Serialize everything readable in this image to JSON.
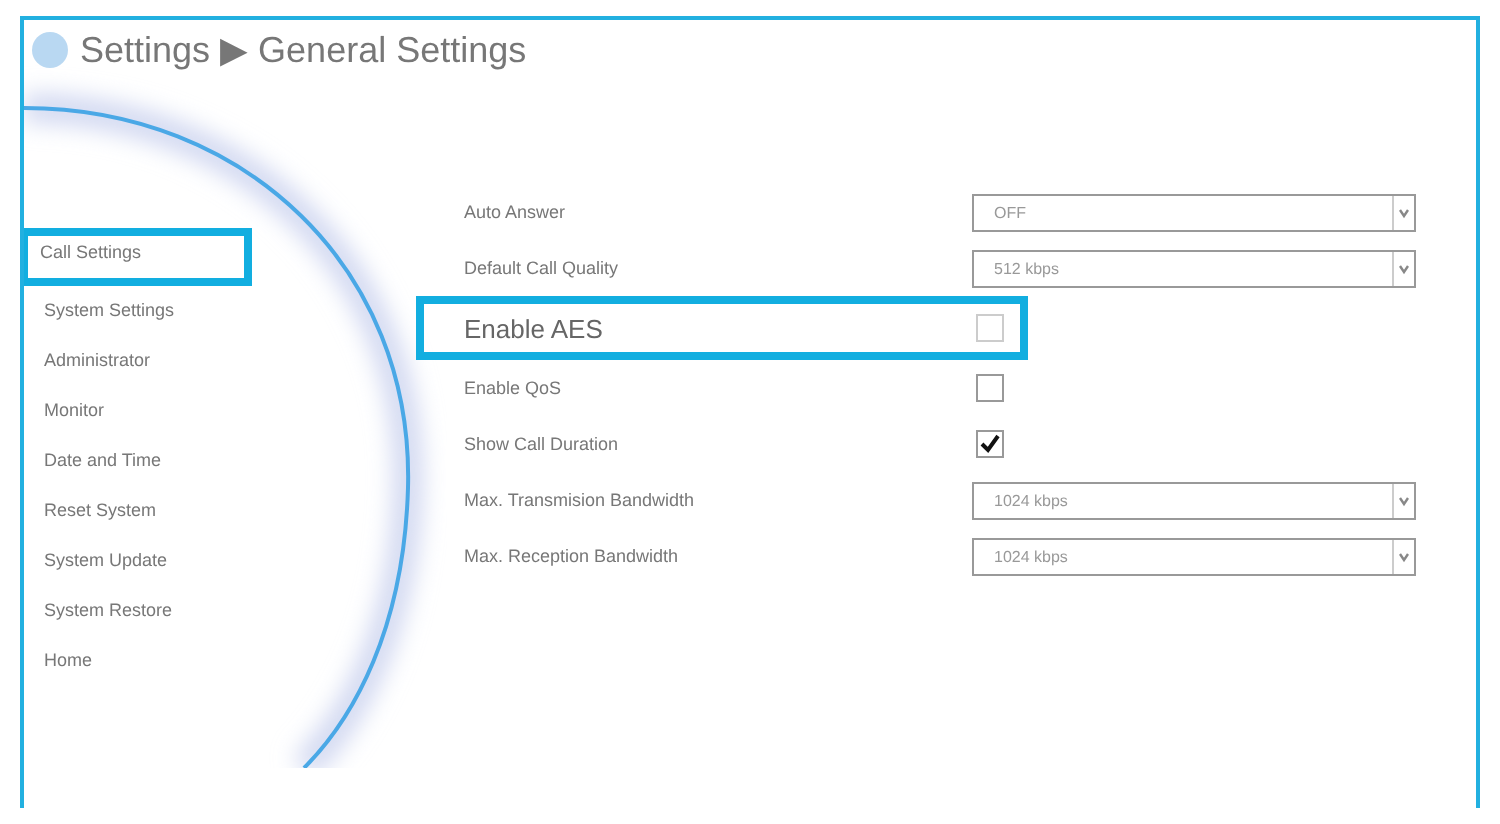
{
  "header": {
    "title": "Settings ▶ General Settings"
  },
  "sidebar": {
    "items": [
      {
        "label": "Call Settings",
        "selected": true
      },
      {
        "label": "System Settings",
        "selected": false
      },
      {
        "label": "Administrator",
        "selected": false
      },
      {
        "label": "Monitor",
        "selected": false
      },
      {
        "label": "Date and Time",
        "selected": false
      },
      {
        "label": "Reset System",
        "selected": false
      },
      {
        "label": "System Update",
        "selected": false
      },
      {
        "label": "System Restore",
        "selected": false
      },
      {
        "label": "Home",
        "selected": false
      }
    ]
  },
  "settings": [
    {
      "kind": "select",
      "label": "Auto Answer",
      "value": "OFF",
      "highlighted": false
    },
    {
      "kind": "select",
      "label": "Default Call Quality",
      "value": "512 kbps",
      "highlighted": false
    },
    {
      "kind": "checkbox",
      "label": "Enable AES",
      "checked": false,
      "highlighted": true
    },
    {
      "kind": "checkbox",
      "label": "Enable QoS",
      "checked": false,
      "highlighted": false
    },
    {
      "kind": "checkbox",
      "label": "Show Call Duration",
      "checked": true,
      "highlighted": false
    },
    {
      "kind": "select",
      "label": "Max. Transmision Bandwidth",
      "value": "1024 kbps",
      "highlighted": false
    },
    {
      "kind": "select",
      "label": "Max. Reception Bandwidth",
      "value": "1024 kbps",
      "highlighted": false
    }
  ]
}
